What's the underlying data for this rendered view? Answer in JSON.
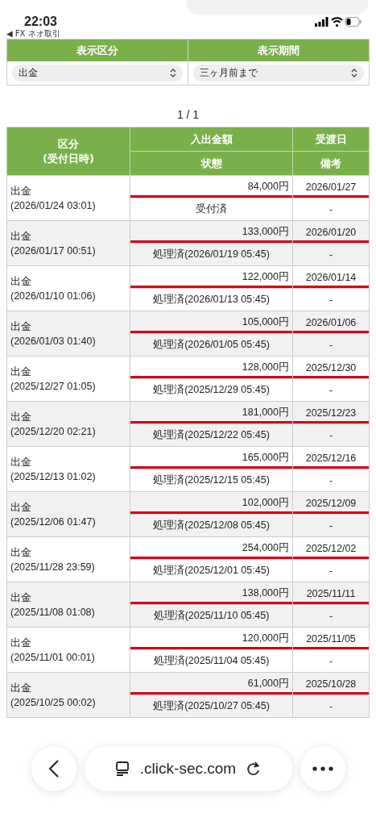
{
  "status_bar": {
    "time": "22:03"
  },
  "back_link": "◀ FX ネオ取引",
  "filters": [
    {
      "label": "表示区分",
      "value": "出金"
    },
    {
      "label": "表示期間",
      "value": "三ヶ月前まで"
    }
  ],
  "pager": "1 / 1",
  "table": {
    "columns": [
      {
        "top": "区分",
        "bottom": "(受付日時)"
      },
      {
        "top": "入出金額",
        "bottom": "状態"
      },
      {
        "top": "受渡日",
        "bottom": "備考"
      }
    ],
    "rows": [
      {
        "type": "出金",
        "received": "(2026/01/24 03:01)",
        "amount": "84,000円",
        "status": "受付済",
        "date": "2026/01/27",
        "note": "-",
        "underlined": true
      },
      {
        "type": "出金",
        "received": "(2026/01/17 00:51)",
        "amount": "133,000円",
        "status": "処理済(2026/01/19 05:45)",
        "date": "2026/01/20",
        "note": "-",
        "underlined": true
      },
      {
        "type": "出金",
        "received": "(2026/01/10 01:06)",
        "amount": "122,000円",
        "status": "処理済(2026/01/13 05:45)",
        "date": "2026/01/14",
        "note": "-",
        "underlined": true
      },
      {
        "type": "出金",
        "received": "(2026/01/03 01:40)",
        "amount": "105,000円",
        "status": "処理済(2026/01/05 05:45)",
        "date": "2026/01/06",
        "note": "-",
        "underlined": true
      },
      {
        "type": "出金",
        "received": "(2025/12/27 01:05)",
        "amount": "128,000円",
        "status": "処理済(2025/12/29 05:45)",
        "date": "2025/12/30",
        "note": "-",
        "underlined": true
      },
      {
        "type": "出金",
        "received": "(2025/12/20 02:21)",
        "amount": "181,000円",
        "status": "処理済(2025/12/22 05:45)",
        "date": "2025/12/23",
        "note": "-",
        "underlined": true
      },
      {
        "type": "出金",
        "received": "(2025/12/13 01:02)",
        "amount": "165,000円",
        "status": "処理済(2025/12/15 05:45)",
        "date": "2025/12/16",
        "note": "-",
        "underlined": true
      },
      {
        "type": "出金",
        "received": "(2025/12/06 01:47)",
        "amount": "102,000円",
        "status": "処理済(2025/12/08 05:45)",
        "date": "2025/12/09",
        "note": "-",
        "underlined": true
      },
      {
        "type": "出金",
        "received": "(2025/11/28 23:59)",
        "amount": "254,000円",
        "status": "処理済(2025/12/01 05:45)",
        "date": "2025/12/02",
        "note": "-",
        "underlined": true
      },
      {
        "type": "出金",
        "received": "(2025/11/08 01:08)",
        "amount": "138,000円",
        "status": "処理済(2025/11/10 05:45)",
        "date": "2025/11/11",
        "note": "-",
        "underlined": true
      },
      {
        "type": "出金",
        "received": "(2025/11/01 00:01)",
        "amount": "120,000円",
        "status": "処理済(2025/11/04 05:45)",
        "date": "2025/11/05",
        "note": "-",
        "underlined": true
      },
      {
        "type": "出金",
        "received": "(2025/10/25 00:02)",
        "amount": "61,000円",
        "status": "処理済(2025/10/27 05:45)",
        "date": "2025/10/28",
        "note": "-",
        "underlined": true
      }
    ]
  },
  "browser_bar": {
    "url": ".click-sec.com"
  }
}
